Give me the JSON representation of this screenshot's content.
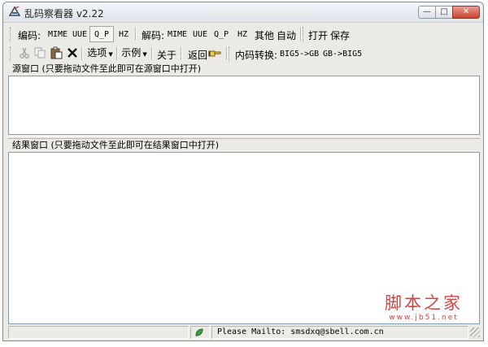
{
  "window": {
    "title": "乱码察看器 v2.22",
    "controls": {
      "minimize": "—",
      "maximize": "□",
      "close": "✕"
    }
  },
  "toolbar_encode": {
    "encode_label": "编码:",
    "encode_buttons": [
      "MIME",
      "UUE",
      "Q_P",
      "HZ"
    ],
    "decode_label": "解码:",
    "decode_buttons": [
      "MIME",
      "UUE",
      "Q_P",
      "HZ",
      "其他",
      "自动"
    ],
    "file_buttons": [
      "打开",
      "保存"
    ]
  },
  "toolbar_edit": {
    "icons": [
      "cut-icon",
      "copy-icon",
      "paste-icon",
      "delete-icon"
    ],
    "options_label": "选项",
    "example_label": "示例",
    "about_label": "关于",
    "back_label": "返回",
    "convert_label": "内码转换:",
    "convert_buttons": [
      "BIG5->GB",
      "GB->BIG5"
    ]
  },
  "source_pane": {
    "label": "源窗口 (只要拖动文件至此即可在源窗口中打开)",
    "content": ""
  },
  "result_pane": {
    "label": "结果窗口 (只要拖动文件至此即可在结果窗口中打开)",
    "content": ""
  },
  "status": {
    "text": "Please Mailto: smsdxq@sbell.com.cn"
  },
  "watermark": {
    "main": "脚本之家",
    "sub": "www.jb51.net"
  },
  "colors": {
    "accent_red": "#d4433f",
    "pane_border": "#7f9db9"
  }
}
